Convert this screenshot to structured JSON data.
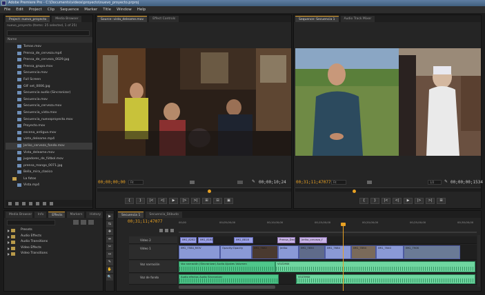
{
  "window": {
    "title": "Adobe Premiere Pro - C:\\Documents\\videos\\proyecto\\nuevo_proyecto.prproj"
  },
  "menu": [
    "File",
    "Edit",
    "Project",
    "Clip",
    "Sequence",
    "Marker",
    "Title",
    "Window",
    "Help"
  ],
  "project": {
    "tabs": [
      "Project: nuevo_proyecto",
      "Media Browser"
    ],
    "path": "nuevo_proyecto  (Items: 25 selected, 1 of 25)",
    "column": "Name",
    "items": [
      {
        "label": "Tomas.mov",
        "sel": false
      },
      {
        "label": "Prensa_de_cerveza.mp4",
        "sel": false
      },
      {
        "label": "Prensa_de_cerveza_0029.jpg",
        "sel": false
      },
      {
        "label": "Prensa_grupo.mov",
        "sel": false
      },
      {
        "label": "Secuencia.mov",
        "sel": false
      },
      {
        "label": "Full Screen",
        "sel": false
      },
      {
        "label": "GIF set_0006.jpg",
        "sel": false
      },
      {
        "label": "Secuencia audio (Sincronizar)",
        "sel": false
      },
      {
        "label": "Secuencia.mov",
        "sel": false
      },
      {
        "label": "Secuencia_cerveza.mov",
        "sel": false
      },
      {
        "label": "Secuencia_vista.mov",
        "sel": false
      },
      {
        "label": "Secuencia_nuevoproyecto.mov",
        "sel": false
      },
      {
        "label": "Proyecto.mov",
        "sel": false
      },
      {
        "label": "escena_antigua.mov",
        "sel": false
      },
      {
        "label": "vista_deleame.mp4",
        "sel": false
      },
      {
        "label": "Jeriko_cerveza_fondo.mov",
        "sel": true
      },
      {
        "label": "Vista_deleame.mov",
        "sel": false
      },
      {
        "label": "jugadores_de_fútbol.mov",
        "sel": false
      },
      {
        "label": "prensa_mango_0071.jpg",
        "sel": false
      },
      {
        "label": "Bella_mira_clasico",
        "sel": false
      },
      {
        "label": "La fotos",
        "sel": false,
        "folder": true
      },
      {
        "label": "Vista.mp4",
        "sel": false
      }
    ]
  },
  "source_monitor": {
    "tabs": [
      "Source: vista_deleame.mov",
      "Effect Controls"
    ],
    "timecode_in": "00;00;00;00",
    "zoom": "Fit",
    "timecode_out": "00;00;10;24",
    "controls": [
      "{",
      "}",
      "|<",
      "<|",
      "▶",
      "|>",
      ">|",
      "⊞",
      "⊟",
      "▣"
    ]
  },
  "program_monitor": {
    "tabs": [
      "Sequence: Secuencia 1",
      "Audio Track Mixer"
    ],
    "timecode_in": "00;31;11;47077",
    "zoom": "Fit",
    "quality": "1/2",
    "timecode_out": "00;00;00;1534",
    "controls": [
      "{",
      "}",
      "|<",
      "<|",
      "▶",
      "|>",
      ">|",
      "⊞"
    ]
  },
  "effects": {
    "tabs": [
      "Media Browser",
      "Info",
      "Effects",
      "Markers",
      "History"
    ],
    "items": [
      "Presets",
      "Audio Effects",
      "Audio Transitions",
      "Video Effects",
      "Video Transitions"
    ]
  },
  "tools": [
    "▶",
    "⇆",
    "✥",
    "⇹",
    "✂",
    "↔",
    "✎",
    "✋",
    "🔍"
  ],
  "timeline": {
    "tabs": [
      "Secuencia 1",
      "Secuencia_Stibudo"
    ],
    "timecode": "00;31;11;47077",
    "ruler": [
      "00;00",
      "00;05;00;00",
      "00;10;00;00",
      "00;15;00;00",
      "00;20;00;00",
      "00;25;00;00",
      "00;30;00;00",
      "00;35;00;00"
    ],
    "tracks": {
      "v2": "Video 2",
      "v1": "Video 1",
      "a1": "Voz narración",
      "a2": "Voz de fondo",
      "a3": ""
    },
    "clips": {
      "v2": [
        "IMG_8282",
        "IMG_8181",
        "IMG_8818",
        "Prensa_Dev",
        "Jeriko_cerveza_f"
      ],
      "v1": [
        "IMG_7584_MOV",
        "Opacity:Opacity",
        "IMG_7682",
        "Jeriko",
        "IMG_7850",
        "IMG_7684",
        "IMG_7894",
        "IMG_7840",
        "IMG_7906"
      ],
      "a1": [
        "Voz narración (Sincronizar) Audio Ajustes Volumen",
        "VOZ2MIX"
      ],
      "a2": [
        "Audio efectos Audio Sincronizar",
        "VOZ3MIX"
      ]
    }
  }
}
